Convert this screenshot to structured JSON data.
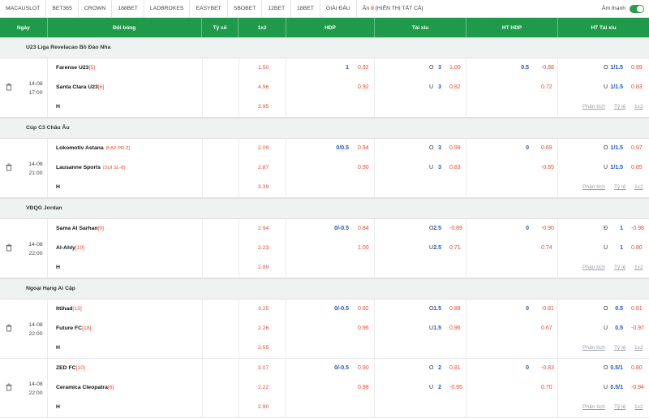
{
  "topbar": {
    "tabs": [
      "MACAUSLOT",
      "BET365",
      "CROWN",
      "188BET",
      "LADBROKES",
      "EASYBET",
      "SBOBET",
      "12BET",
      "18BET",
      "GIẢI ĐẤU"
    ],
    "hide_label": "Ẩn",
    "hide_count": "0",
    "show_all": "[HIỂN THỊ TẤT CẢ]",
    "sound_label": "Âm thanh",
    "sound_on": true
  },
  "header": {
    "date": "Ngày",
    "teams": "Đội bóng",
    "score": "Tỷ số",
    "x12": "1x2",
    "hdp": "HDP",
    "ou": "Tài xỉu",
    "ht_hdp": "HT HDP",
    "ht_ou": "HT Tài xỉu"
  },
  "links": {
    "analysis": "Phân tích",
    "odds": "Tỷ lệ",
    "x12": "1x2"
  },
  "colors": {
    "header_green": "#1f9a4a",
    "odds_red": "#e8482f",
    "line_blue": "#1a56c9"
  },
  "matches": [
    {
      "league": "U23 Liga Revelacao Bồ Đào Nha",
      "date": "14-08",
      "time": "17:00",
      "home": "Farense U23",
      "home_rank": "[5]",
      "home_tag": "",
      "away": "Santa Clara U23",
      "away_rank": "[6]",
      "away_tag": "",
      "draw_label": "H",
      "x12": [
        "1.50",
        "4.96",
        "3.95"
      ],
      "hdp_line": "1",
      "hdp": [
        "0.92",
        "0.92"
      ],
      "ou_o": "O",
      "ou_u": "U",
      "ou_line": [
        "3",
        "3"
      ],
      "ou": [
        "1.00",
        "0.82"
      ],
      "hthdp_line": "0.5",
      "hthdp": [
        "-0.88",
        "0.72"
      ],
      "htou_o": "O",
      "htou_u": "U",
      "htou_line": [
        "1/1.5",
        "1/1.5"
      ],
      "htou": [
        "0.99",
        "0.83"
      ]
    },
    {
      "league": "Cúp C3 Châu Âu",
      "date": "14-08",
      "time": "21:00",
      "home": "Lokomotiv Astana",
      "home_rank": "",
      "home_tag": "[KAZ PR-2]",
      "away": "Lausanne Sports",
      "away_rank": "",
      "away_tag": "[SUI SL-8]",
      "draw_label": "H",
      "x12": [
        "2.09",
        "2.87",
        "3.39"
      ],
      "hdp_line": "0/0.5",
      "hdp": [
        "0.94",
        "0.90"
      ],
      "ou_o": "O",
      "ou_u": "U",
      "ou_line": [
        "3",
        "3"
      ],
      "ou": [
        "0.99",
        "0.83"
      ],
      "hthdp_line": "0",
      "hthdp": [
        "0.69",
        "-0.85"
      ],
      "htou_o": "O",
      "htou_u": "U",
      "htou_line": [
        "1/1.5",
        "1/1.5"
      ],
      "htou": [
        "0.97",
        "0.85"
      ]
    },
    {
      "league": "VĐQG Jordan",
      "date": "14-08",
      "time": "22:00",
      "home": "Sama Al Sarhan",
      "home_rank": "[9]",
      "home_tag": "",
      "away": "Al-Ahly",
      "away_rank": "[10]",
      "away_tag": "",
      "draw_label": "H",
      "x12": [
        "2.94",
        "2.23",
        "2.99"
      ],
      "hdp_line": "0/-0.5",
      "hdp": [
        "0.84",
        "1.00"
      ],
      "ou_o": "O",
      "ou_u": "U",
      "ou_line": [
        "2.5",
        "2.5"
      ],
      "ou": [
        "-0.89",
        "0.71"
      ],
      "hthdp_line": "0",
      "hthdp": [
        "-0.90",
        "0.74"
      ],
      "htou_o": "Đ",
      "htou_u": "U",
      "htou_line": [
        "1",
        "1"
      ],
      "htou": [
        "-0.98",
        "0.80"
      ]
    },
    {
      "league": "Ngoại Hạng Ai Cập",
      "date": "14-08",
      "time": "22:00",
      "home": "Ittihad",
      "home_rank": "[13]",
      "home_tag": "",
      "away": "Future FC",
      "away_rank": "[18]",
      "away_tag": "",
      "draw_label": "H",
      "x12": [
        "3.25",
        "2.26",
        "2.55"
      ],
      "hdp_line": "0/-0.5",
      "hdp": [
        "0.92",
        "0.96"
      ],
      "ou_o": "O",
      "ou_u": "U",
      "ou_line": [
        "1.5",
        "1.5"
      ],
      "ou": [
        "0.88",
        "0.96"
      ],
      "hthdp_line": "0",
      "hthdp": [
        "-0.81",
        "0.67"
      ],
      "htou_o": "O",
      "htou_u": "U",
      "htou_line": [
        "0.5",
        "0.5"
      ],
      "htou": [
        "0.81",
        "-0.97"
      ]
    },
    {
      "league": "",
      "date": "14-08",
      "time": "22:00",
      "home": "ZED FC",
      "home_rank": "[10]",
      "home_tag": "",
      "away": "Ceramica Cleopatra",
      "away_rank": "[6]",
      "away_tag": "",
      "draw_label": "H",
      "x12": [
        "3.07",
        "2.22",
        "2.90"
      ],
      "hdp_line": "0/-0.5",
      "hdp": [
        "0.90",
        "0.98"
      ],
      "ou_o": "O",
      "ou_u": "U",
      "ou_line": [
        "2",
        "2"
      ],
      "ou": [
        "0.81",
        "-0.95"
      ],
      "hthdp_line": "0",
      "hthdp": [
        "-0.83",
        "0.70"
      ],
      "htou_o": "O",
      "htou_u": "U",
      "htou_line": [
        "0.5/1",
        "0.5/1"
      ],
      "htou": [
        "0.80",
        "-0.94"
      ]
    }
  ]
}
